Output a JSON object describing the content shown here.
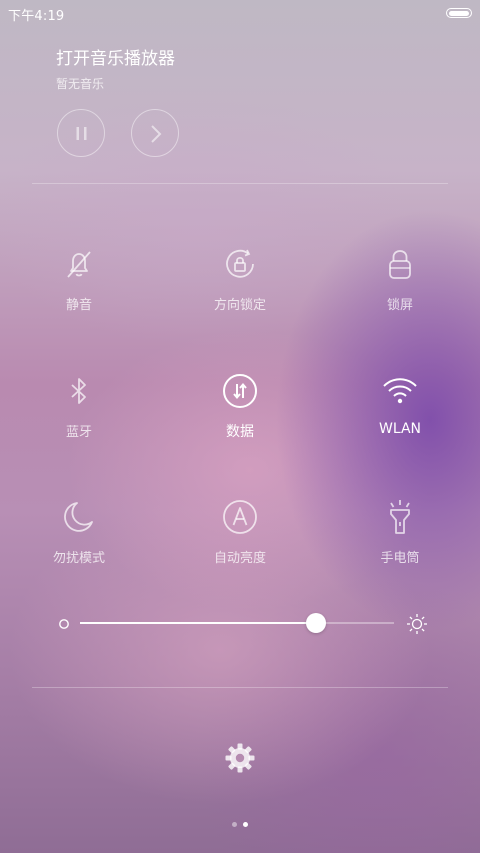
{
  "status_bar": {
    "time": "下午4:19"
  },
  "music": {
    "title": "打开音乐播放器",
    "subtitle": "暂无音乐",
    "pause_icon": "pause-icon",
    "next_icon": "next-icon"
  },
  "toggles": [
    {
      "label": "静音",
      "icon": "mute-bell-icon",
      "active": false
    },
    {
      "label": "方向锁定",
      "icon": "rotation-lock-icon",
      "active": false
    },
    {
      "label": "锁屏",
      "icon": "lock-icon",
      "active": false
    },
    {
      "label": "蓝牙",
      "icon": "bluetooth-icon",
      "active": false
    },
    {
      "label": "数据",
      "icon": "mobile-data-icon",
      "active": true
    },
    {
      "label": "WLAN",
      "icon": "wifi-icon",
      "active": true
    },
    {
      "label": "勿扰模式",
      "icon": "moon-icon",
      "active": false
    },
    {
      "label": "自动亮度",
      "icon": "auto-brightness-icon",
      "active": false
    },
    {
      "label": "手电筒",
      "icon": "flashlight-icon",
      "active": false
    }
  ],
  "brightness": {
    "level": 0.75,
    "min_icon": "brightness-low-icon",
    "max_icon": "brightness-high-icon"
  },
  "settings": {
    "icon": "gear-icon"
  },
  "pager": {
    "pages": 2,
    "current": 2
  },
  "colors": {
    "text": "#ffffff",
    "inactive_text": "rgba(255,255,255,0.75)",
    "accent": "#ffffff"
  }
}
